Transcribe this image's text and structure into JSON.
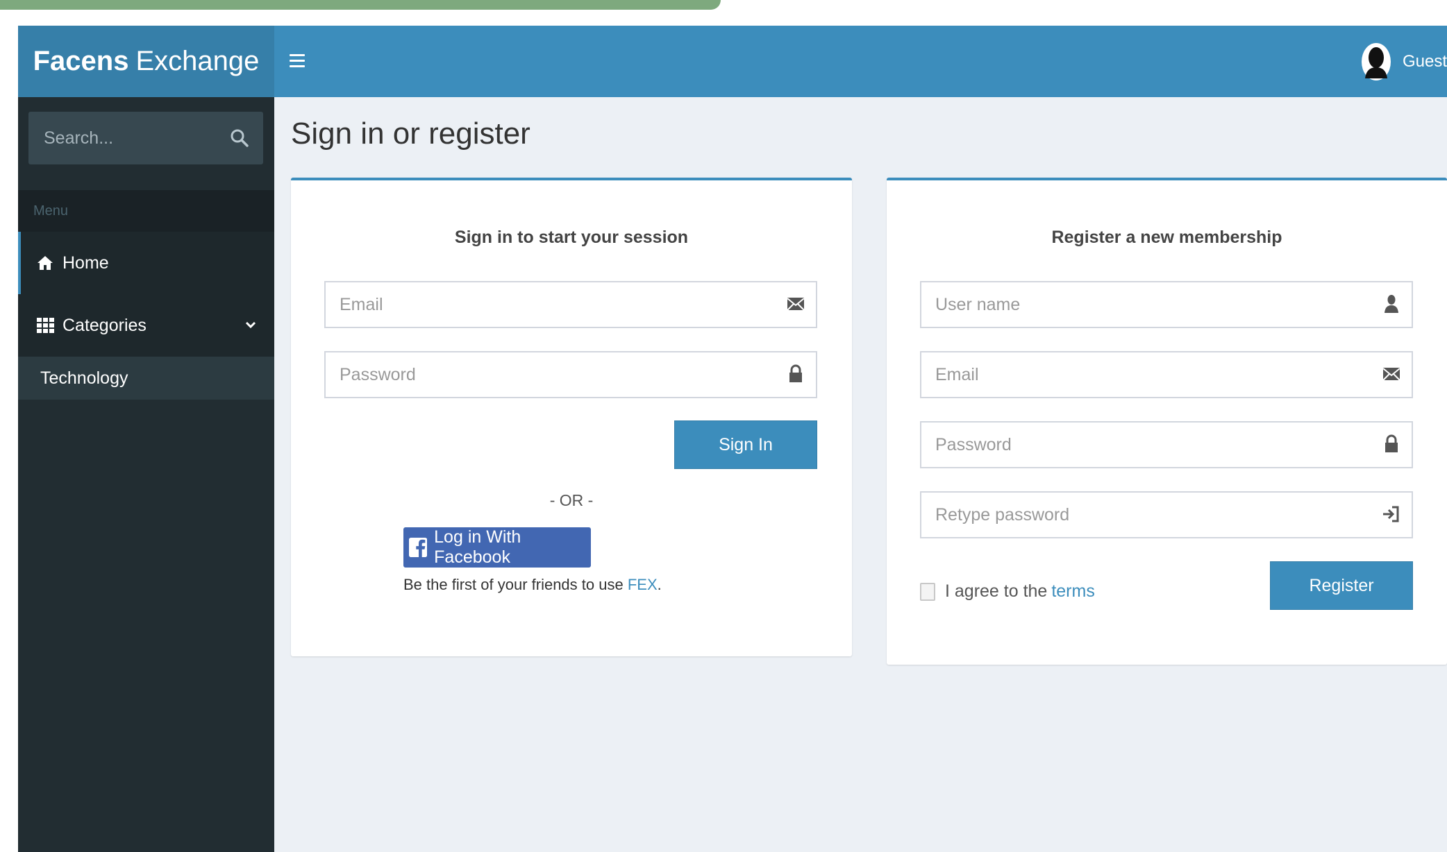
{
  "brand": {
    "bold": "Facens",
    "light": "Exchange"
  },
  "header": {
    "user_name": "Guest"
  },
  "sidebar": {
    "search_placeholder": "Search...",
    "menu_header": "Menu",
    "items": [
      {
        "label": "Home",
        "icon": "home-icon"
      },
      {
        "label": "Categories",
        "icon": "grid-icon"
      }
    ],
    "submenu": [
      {
        "label": "Technology"
      }
    ]
  },
  "page": {
    "title": "Sign in or register"
  },
  "login": {
    "title": "Sign in to start your session",
    "email_placeholder": "Email",
    "password_placeholder": "Password",
    "submit_label": "Sign In",
    "or_text": "- OR -",
    "facebook_label": "Log in With Facebook",
    "facebook_note": "Be the first of your friends to use ",
    "facebook_note_link": "FEX",
    "facebook_note_end": "."
  },
  "register": {
    "title": "Register a new membership",
    "username_placeholder": "User name",
    "email_placeholder": "Email",
    "password_placeholder": "Password",
    "retype_placeholder": "Retype password",
    "agree_text": "I agree to the",
    "terms_link": "terms",
    "submit_label": "Register"
  },
  "colors": {
    "primary": "#3c8dbc",
    "primary_dark": "#367fa9",
    "sidebar_bg": "#222d32",
    "content_bg": "#ecf0f5",
    "facebook": "#4267b2"
  }
}
